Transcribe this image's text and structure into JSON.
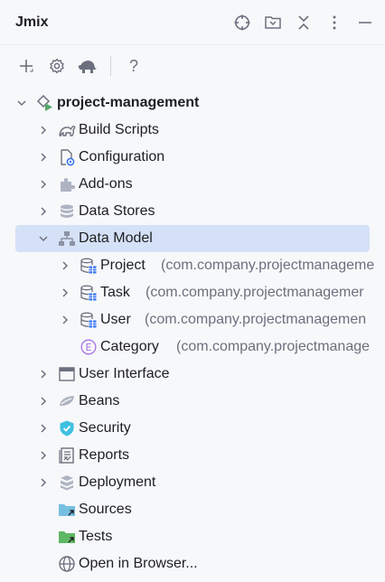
{
  "header": {
    "title": "Jmix",
    "actions": [
      "crosshair-icon",
      "collapse-frame-icon",
      "collapse-all-icon",
      "more-vertical-icon",
      "minimize-icon"
    ]
  },
  "toolbar": {
    "buttons": [
      "plus-icon",
      "gear-icon",
      "turtle-icon",
      "help-icon"
    ],
    "help_label": "?"
  },
  "tree": {
    "root": {
      "label": "project-management",
      "expanded": true
    },
    "build_scripts": {
      "label": "Build Scripts"
    },
    "configuration": {
      "label": "Configuration"
    },
    "add_ons": {
      "label": "Add-ons"
    },
    "data_stores": {
      "label": "Data Stores"
    },
    "data_model": {
      "label": "Data Model",
      "expanded": true,
      "selected": true
    },
    "project": {
      "label": "Project",
      "package": "(com.company.projectmanageme"
    },
    "task": {
      "label": "Task",
      "package": "(com.company.projectmanagemer"
    },
    "user": {
      "label": "User",
      "package": "(com.company.projectmanagemen"
    },
    "category": {
      "label": "Category",
      "package": "(com.company.projectmanage"
    },
    "user_interface": {
      "label": "User Interface"
    },
    "beans": {
      "label": "Beans"
    },
    "security": {
      "label": "Security"
    },
    "reports": {
      "label": "Reports"
    },
    "deployment": {
      "label": "Deployment"
    },
    "sources": {
      "label": "Sources"
    },
    "tests": {
      "label": "Tests"
    },
    "open_in_browser": {
      "label": "Open in Browser..."
    }
  },
  "colors": {
    "selection": "#d5e1f6",
    "package_text": "#6c707e",
    "icon_gray": "#6c707e",
    "icon_blue": "#3574f0",
    "enum_purple": "#a571e6",
    "security_teal": "#3ec0e0",
    "sources_folder": "#77bfe0",
    "tests_folder": "#5fb865",
    "run_green": "#55a76a"
  }
}
